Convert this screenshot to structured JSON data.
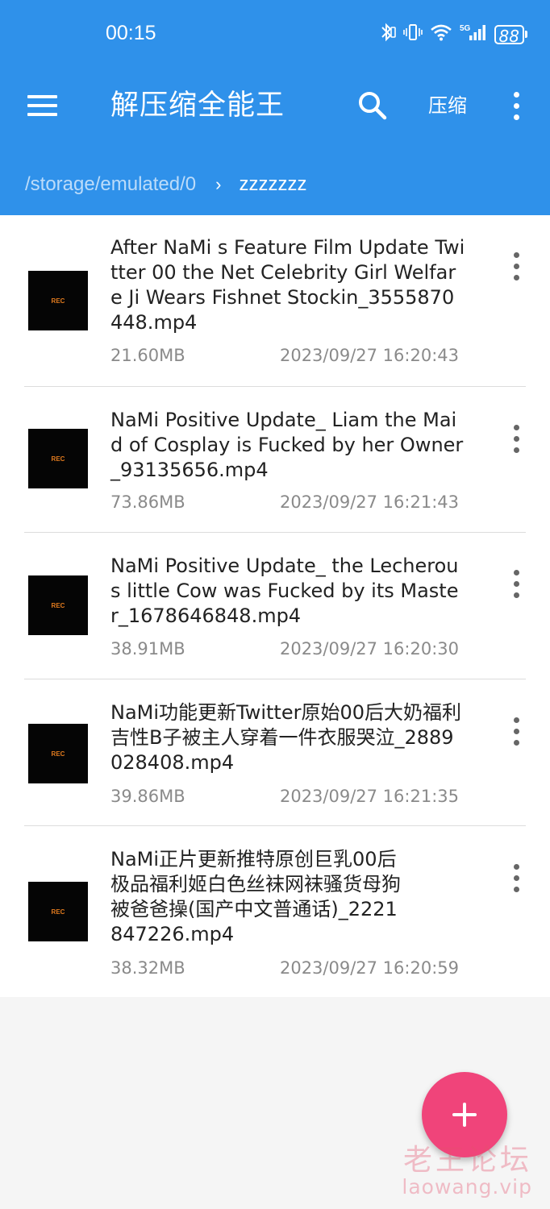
{
  "status_bar": {
    "time": "00:15",
    "battery": "88",
    "icons": [
      "bluetooth-icon",
      "vibrate-icon",
      "wifi-icon",
      "5g-signal-icon",
      "battery-icon"
    ],
    "network_label": "5G"
  },
  "toolbar": {
    "title": "解压缩全能王",
    "compress_label": "压缩",
    "icons": [
      "menu-icon",
      "search-icon",
      "more-vert-icon"
    ]
  },
  "breadcrumb": {
    "root": "/storage/emulated/0",
    "separator": "›",
    "current": "zzzzzzz"
  },
  "files": [
    {
      "name": "After NaMi s Feature Film Update Twitter 00  the Net Celebrity Girl Welfare Ji Wears Fishnet Stockin_3555870448.mp4",
      "size": "21.60MB",
      "date": "2023/09/27 16:20:43",
      "thumb_label": "REC"
    },
    {
      "name": "NaMi Positive Update_ Liam the Maid of Cosplay is Fucked by her Owner_93135656.mp4",
      "size": "73.86MB",
      "date": "2023/09/27 16:21:43",
      "thumb_label": "REC"
    },
    {
      "name": "NaMi Positive Update_ the Lecherous little Cow was Fucked by its Master_1678646848.mp4",
      "size": "38.91MB",
      "date": "2023/09/27 16:20:30",
      "thumb_label": "REC"
    },
    {
      "name": "NaMi功能更新Twitter原始00后大奶福利吉性B子被主人穿着一件衣服哭泣_2889028408.mp4",
      "size": "39.86MB",
      "date": "2023/09/27 16:21:35",
      "thumb_label": "REC"
    },
    {
      "name": "NaMi正片更新推特原创巨乳00后极品福利姬白色丝袜网袜骚货母狗被爸爸操(国产中文普通话)_2221847226.mp4",
      "size": "38.32MB",
      "date": "2023/09/27 16:20:59",
      "thumb_label": "REC"
    }
  ],
  "fab": {
    "icon": "plus-icon",
    "label": "+"
  },
  "watermark": {
    "line1": "老王论坛",
    "line2": "laowang.vip"
  },
  "colors": {
    "app_bar": "#2f91ea",
    "fab": "#f0447a",
    "list_bg": "#ffffff",
    "page_bg": "#f5f5f5"
  }
}
